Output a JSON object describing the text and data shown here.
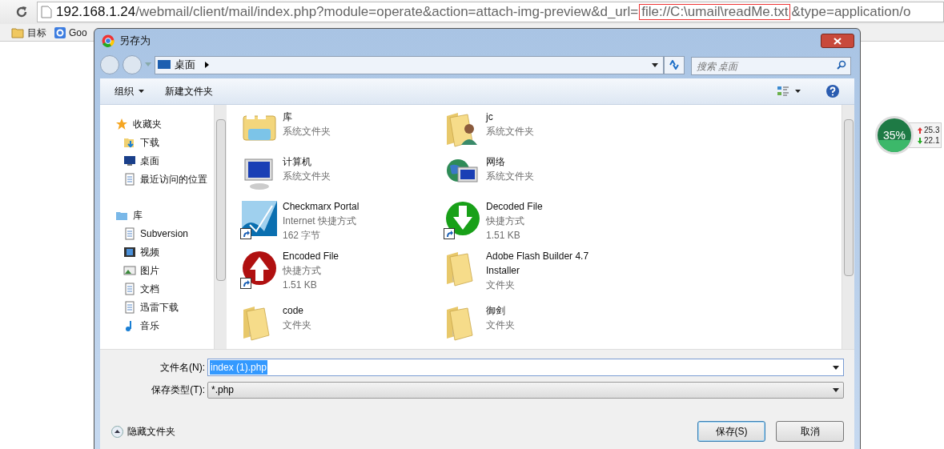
{
  "browser": {
    "url_parts": [
      {
        "kind": "host",
        "text": "192.168.1.24"
      },
      {
        "kind": "path",
        "text": "/webmail/client/mail/index.php?module=operate&action=attach-img-preview&d_url="
      },
      {
        "kind": "highlight",
        "text": "file://C:\\umail\\readMe.txt"
      },
      {
        "kind": "path",
        "text": "&type=application/o"
      }
    ],
    "bookmarks": [
      {
        "label": "目标"
      },
      {
        "label": "Goo"
      }
    ]
  },
  "widget": {
    "percent": "35%",
    "up": "25.3",
    "down": "22.1"
  },
  "dialog": {
    "title": "另存为",
    "location": "桌面",
    "search": {
      "placeholder": "搜索 桌面"
    },
    "toolbar": [
      "组织",
      "新建文件夹"
    ],
    "nav": [
      {
        "label": "收藏夹",
        "children": [
          {
            "label": "下载"
          },
          {
            "label": "桌面"
          },
          {
            "label": "最近访问的位置"
          }
        ]
      },
      {
        "label": "库",
        "children": [
          {
            "label": "Subversion"
          },
          {
            "label": "视频"
          },
          {
            "label": "图片"
          },
          {
            "label": "文档"
          },
          {
            "label": "迅雷下载"
          },
          {
            "label": "音乐"
          }
        ]
      }
    ],
    "files": [
      {
        "name": "库",
        "details": [
          "系统文件夹"
        ],
        "shortcut": false
      },
      {
        "name": "jc",
        "details": [
          "系统文件夹"
        ],
        "shortcut": false
      },
      {
        "name": "计算机",
        "details": [
          "系统文件夹"
        ],
        "shortcut": false
      },
      {
        "name": "网络",
        "details": [
          "系统文件夹"
        ],
        "shortcut": false
      },
      {
        "name": "Checkmarx Portal",
        "details": [
          "Internet 快捷方式",
          "162 字节"
        ],
        "shortcut": true
      },
      {
        "name": "Decoded File",
        "details": [
          "快捷方式",
          "1.51 KB"
        ],
        "shortcut": true
      },
      {
        "name": "Encoded File",
        "details": [
          "快捷方式",
          "1.51 KB"
        ],
        "shortcut": true
      },
      {
        "name": "Adobe Flash Builder 4.7 Installer",
        "details": [
          "文件夹"
        ],
        "shortcut": false
      },
      {
        "name": "code",
        "details": [
          "文件夹"
        ],
        "shortcut": false
      },
      {
        "name": "御剑",
        "details": [
          "文件夹"
        ],
        "shortcut": false
      }
    ],
    "filename": {
      "label": "文件名(N):",
      "value": "index (1).php",
      "selected": true
    },
    "filetype": {
      "label": "保存类型(T):",
      "value": "*.php"
    },
    "hide_folders": "隐藏文件夹",
    "buttons": [
      {
        "label": "保存(S)",
        "default": true
      },
      {
        "label": "取消",
        "default": false
      }
    ]
  }
}
